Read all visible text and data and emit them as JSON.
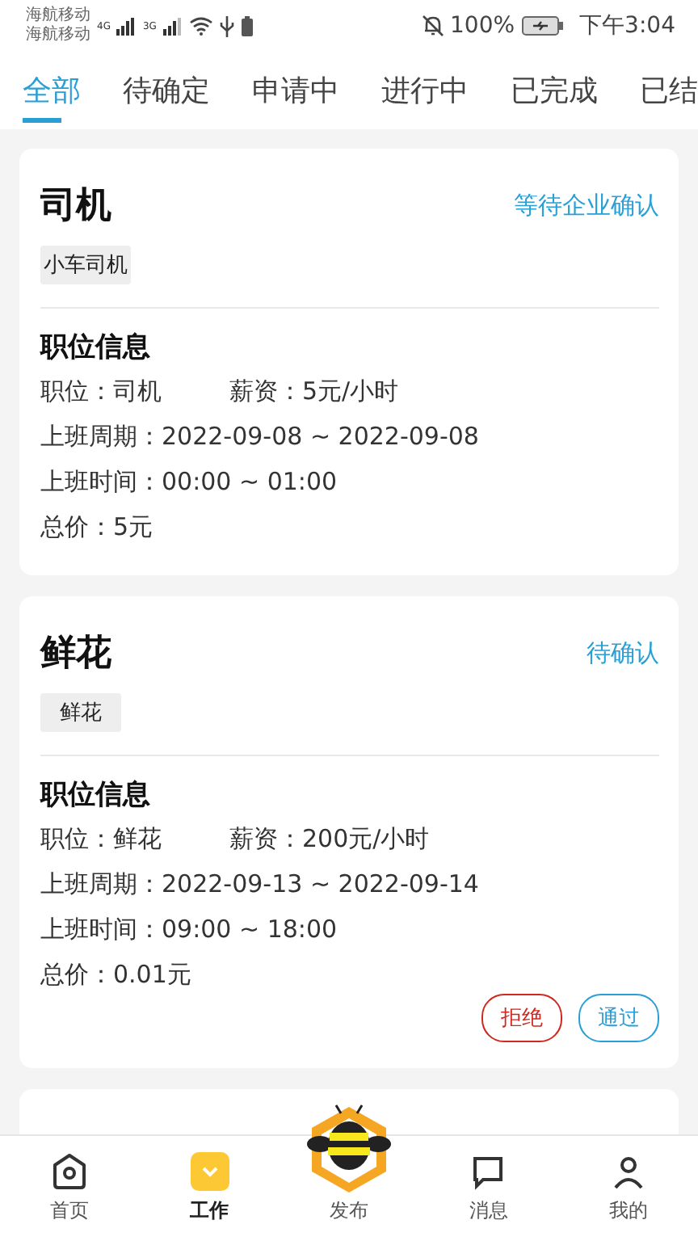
{
  "status_bar": {
    "carriers": [
      "海航移动",
      "海航移动"
    ],
    "networks": [
      "4G",
      "3G"
    ],
    "battery": "100%",
    "time": "下午3:04"
  },
  "tabs": [
    {
      "label": "全部",
      "selected": true
    },
    {
      "label": "待确定",
      "selected": false
    },
    {
      "label": "申请中",
      "selected": false
    },
    {
      "label": "进行中",
      "selected": false
    },
    {
      "label": "已完成",
      "selected": false
    },
    {
      "label": "已结",
      "selected": false
    }
  ],
  "cards": [
    {
      "title": "司机",
      "status": "等待企业确认",
      "tag": "小车司机",
      "section_title": "职位信息",
      "position": "职位：司机",
      "salary": "薪资：5元/小时",
      "period": "上班周期：2022-09-08 ~ 2022-09-08",
      "hours": "上班时间：00:00 ~ 01:00",
      "total": "总价：5元"
    },
    {
      "title": "鲜花",
      "status": "待确认",
      "tag": "鲜花",
      "section_title": "职位信息",
      "position": "职位：鲜花",
      "salary": "薪资：200元/小时",
      "period": "上班周期：2022-09-13 ~ 2022-09-14",
      "hours": "上班时间：09:00 ~ 18:00",
      "total": "总价：0.01元",
      "buttons": [
        {
          "label": "拒绝",
          "kind": "reject"
        },
        {
          "label": "通过",
          "kind": "accept"
        }
      ]
    }
  ],
  "nav": [
    {
      "label": "首页",
      "kind": "home",
      "selected": false
    },
    {
      "label": "工作",
      "kind": "work",
      "selected": true
    },
    {
      "label": "发布",
      "kind": "publish",
      "selected": false
    },
    {
      "label": "消息",
      "kind": "message",
      "selected": false
    },
    {
      "label": "我的",
      "kind": "profile",
      "selected": false
    }
  ]
}
